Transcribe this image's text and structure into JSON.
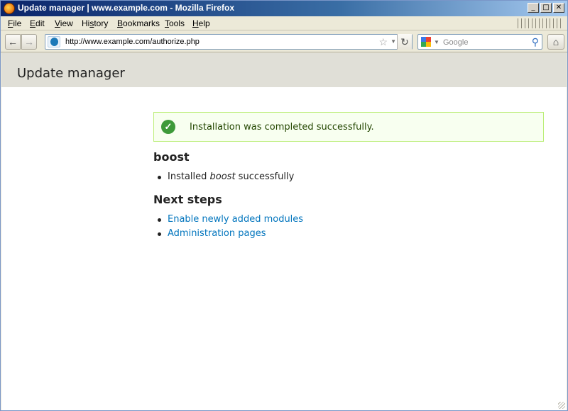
{
  "window": {
    "title": "Update manager | www.example.com - Mozilla Firefox",
    "controls": {
      "minimize": "_",
      "maximize": "□",
      "close": "✕"
    }
  },
  "menubar": {
    "items": [
      {
        "label": "File",
        "accel": "F"
      },
      {
        "label": "Edit",
        "accel": "E"
      },
      {
        "label": "View",
        "accel": "V"
      },
      {
        "label": "History",
        "accel": "s"
      },
      {
        "label": "Bookmarks",
        "accel": "B"
      },
      {
        "label": "Tools",
        "accel": "T"
      },
      {
        "label": "Help",
        "accel": "H"
      }
    ]
  },
  "navbar": {
    "back_icon": "←",
    "forward_icon": "→",
    "url": "http://www.example.com/authorize.php",
    "star_icon": "☆",
    "reload_icon": "↻",
    "search_placeholder": "Google",
    "search_icon": "🔍",
    "home_icon": "⌂"
  },
  "page": {
    "header_title": "Update manager",
    "message": "Installation was completed successfully.",
    "project_heading": "boost",
    "installed": {
      "prefix": "Installed ",
      "project": "boost",
      "suffix": " successfully"
    },
    "next_steps_heading": "Next steps",
    "next_steps": [
      {
        "label": "Enable newly added modules"
      },
      {
        "label": "Administration pages"
      }
    ]
  },
  "colors": {
    "link": "#0074bd",
    "success_bg": "#f8fff0",
    "success_border": "#bbee77",
    "success_icon": "#3e9a3a",
    "header_bg": "#e0dfd7"
  }
}
